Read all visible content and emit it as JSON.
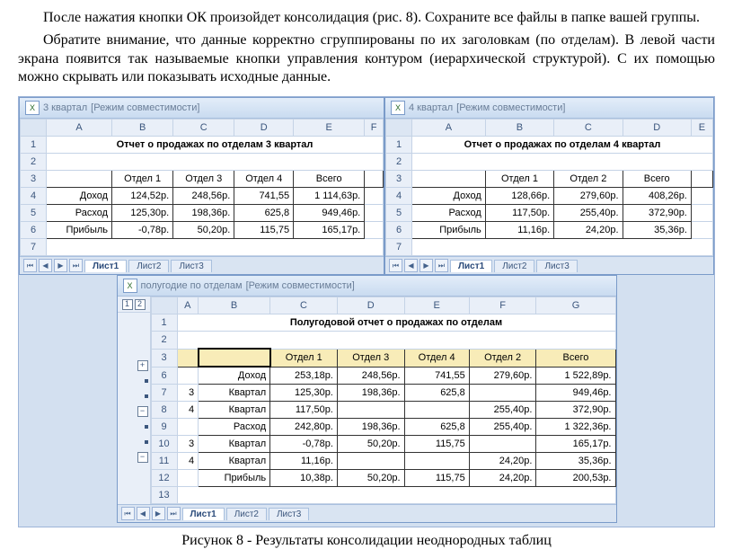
{
  "paragraphs": {
    "p1": "После нажатия кнопки ОК произойдет консолидация (рис. 8). Сохраните все файлы в папке вашей группы.",
    "p2": "Обратите внимание, что данные корректно сгруппированы по их заголовкам (по отделам). В левой части экрана появится так называемые кнопки управления контуром (иерархической структурой). С их помощью можно скрывать или показывать исходные данные."
  },
  "caption": "Рисунок 8 - Результаты консолидации неоднородных таблиц",
  "q3": {
    "title": "3 квартал",
    "mode": "[Режим совместимости]",
    "header_title": "Отчет о продажах по отделам 3 квартал",
    "cols": [
      "A",
      "B",
      "C",
      "D",
      "E",
      "F"
    ],
    "colnames": {
      "b": "Отдел 1",
      "c": "Отдел 3",
      "d": "Отдел 4",
      "e": "Всего"
    },
    "rows": {
      "r4": {
        "a": "Доход",
        "b": "124,52р.",
        "c": "248,56р.",
        "d": "741,55",
        "e": "1 114,63р."
      },
      "r5": {
        "a": "Расход",
        "b": "125,30р.",
        "c": "198,36р.",
        "d": "625,8",
        "e": "949,46р."
      },
      "r6": {
        "a": "Прибыль",
        "b": "-0,78р.",
        "c": "50,20р.",
        "d": "115,75",
        "e": "165,17р."
      }
    }
  },
  "q4": {
    "title": "4 квартал",
    "mode": "[Режим совместимости]",
    "header_title": "Отчет о продажах по отделам 4 квартал",
    "cols": [
      "A",
      "B",
      "C",
      "D",
      "E"
    ],
    "colnames": {
      "b": "Отдел 1",
      "c": "Отдел 2",
      "d": "Всего"
    },
    "rows": {
      "r4": {
        "a": "Доход",
        "b": "128,66р.",
        "c": "279,60р.",
        "d": "408,26р."
      },
      "r5": {
        "a": "Расход",
        "b": "117,50р.",
        "c": "255,40р.",
        "d": "372,90р."
      },
      "r6": {
        "a": "Прибыль",
        "b": "11,16р.",
        "c": "24,20р.",
        "d": "35,36р."
      }
    }
  },
  "half": {
    "title": "полугодие по отделам",
    "mode": "[Режим совместимости]",
    "header_title": "Полугодовой отчет о продажах по отделам",
    "cols": [
      "A",
      "B",
      "C",
      "D",
      "E",
      "F",
      "G"
    ],
    "colnames": {
      "c": "Отдел 1",
      "d": "Отдел 3",
      "e": "Отдел 4",
      "f": "Отдел 2",
      "g": "Всего"
    },
    "rows": {
      "r6": {
        "b": "Доход",
        "c": "253,18р.",
        "d": "248,56р.",
        "e": "741,55",
        "f": "279,60р.",
        "g": "1 522,89р."
      },
      "r7": {
        "a": "3",
        "b": "Квартал",
        "c": "125,30р.",
        "d": "198,36р.",
        "e": "625,8",
        "f": "",
        "g": "949,46р."
      },
      "r8": {
        "a": "4",
        "b": "Квартал",
        "c": "117,50р.",
        "d": "",
        "e": "",
        "f": "255,40р.",
        "g": "372,90р."
      },
      "r9": {
        "b": "Расход",
        "c": "242,80р.",
        "d": "198,36р.",
        "e": "625,8",
        "f": "255,40р.",
        "g": "1 322,36р."
      },
      "r10": {
        "a": "3",
        "b": "Квартал",
        "c": "-0,78р.",
        "d": "50,20р.",
        "e": "115,75",
        "f": "",
        "g": "165,17р."
      },
      "r11": {
        "a": "4",
        "b": "Квартал",
        "c": "11,16р.",
        "d": "",
        "e": "",
        "f": "24,20р.",
        "g": "35,36р."
      },
      "r12": {
        "b": "Прибыль",
        "c": "10,38р.",
        "d": "50,20р.",
        "e": "115,75",
        "f": "24,20р.",
        "g": "200,53р."
      }
    },
    "outline": {
      "h1": "1",
      "h2": "2"
    }
  },
  "tabs": {
    "t1": "Лист1",
    "t2": "Лист2",
    "t3": "Лист3"
  },
  "icons": {
    "xls": "X",
    "first": "⏮",
    "prev": "◀",
    "next": "▶",
    "last": "⏭",
    "plus": "+",
    "minus": "−"
  }
}
